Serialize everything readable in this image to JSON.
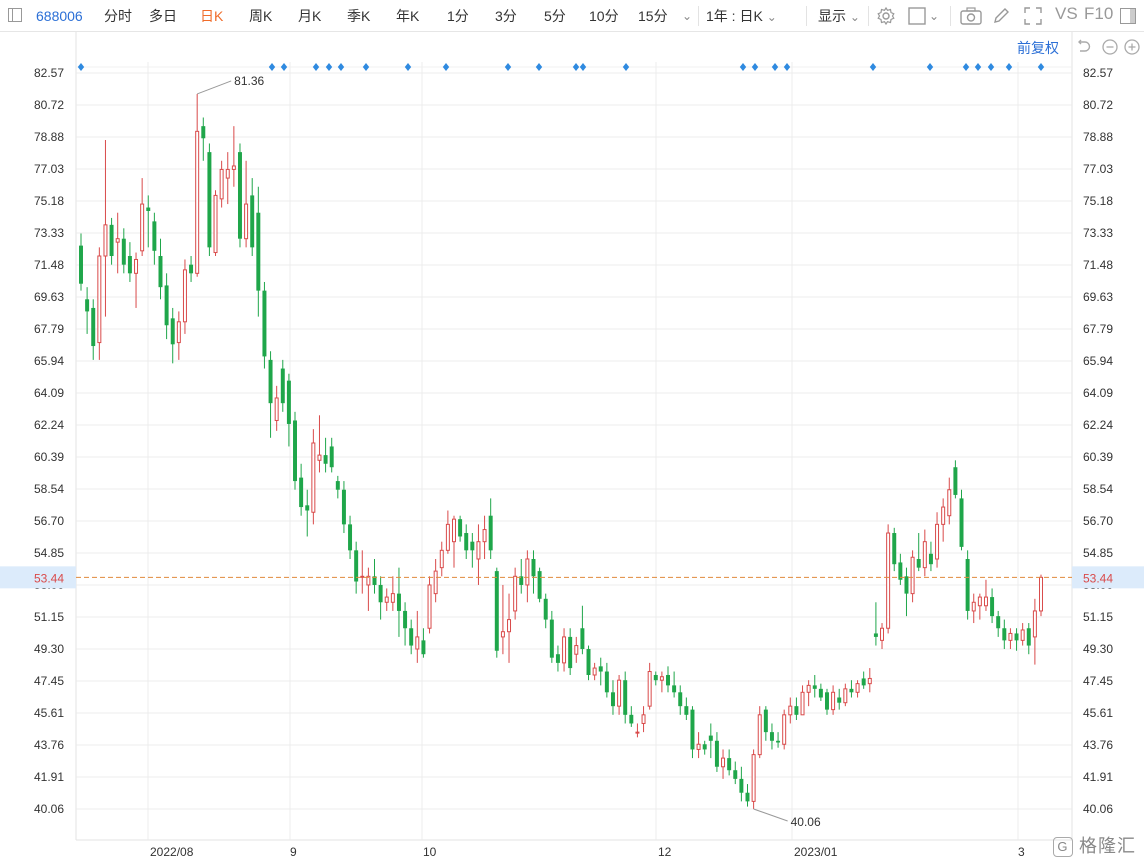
{
  "toolbar": {
    "stock_code": "688006",
    "periods": [
      "分时",
      "多日",
      "日K",
      "周K",
      "月K",
      "季K",
      "年K",
      "1分",
      "3分",
      "5分",
      "10分",
      "15分"
    ],
    "active_period": "日K",
    "range_select": "1年 : 日K",
    "display_label": "显示",
    "vs_label": "VS",
    "f10_label": "F10"
  },
  "chart_header": {
    "adjust_label": "前复权"
  },
  "chart_data": {
    "type": "candlestick",
    "y_ticks": [
      "82.57",
      "80.72",
      "78.88",
      "77.03",
      "75.18",
      "73.33",
      "71.48",
      "69.63",
      "67.79",
      "65.94",
      "64.09",
      "62.24",
      "60.39",
      "58.54",
      "56.70",
      "54.85",
      "53.00",
      "51.15",
      "49.30",
      "47.45",
      "45.61",
      "43.76",
      "41.91",
      "40.06"
    ],
    "ylim": [
      40.06,
      82.57
    ],
    "x_labels": [
      "2022/08",
      "9",
      "10",
      "12",
      "2023/01",
      "3"
    ],
    "current_price": "53.44",
    "current_price_value": 53.44,
    "annotations": [
      {
        "text": "81.36",
        "value": 81.36,
        "kind": "high"
      },
      {
        "text": "40.06",
        "value": 40.06,
        "kind": "low"
      }
    ],
    "colors": {
      "up": "#d94a4a",
      "down": "#1fa64a",
      "grid": "#ececec",
      "price_line": "#e08a3c",
      "price_tag_bg": "#dcebfb",
      "event_marker": "#2f8ae0"
    },
    "candles": [
      {
        "o": 72.6,
        "h": 73.3,
        "l": 70.0,
        "c": 70.4
      },
      {
        "o": 69.5,
        "h": 70.2,
        "l": 67.5,
        "c": 68.8
      },
      {
        "o": 69.0,
        "h": 69.5,
        "l": 66.0,
        "c": 66.8
      },
      {
        "o": 67.0,
        "h": 72.5,
        "l": 66.0,
        "c": 72.0
      },
      {
        "o": 72.0,
        "h": 78.7,
        "l": 68.5,
        "c": 73.8
      },
      {
        "o": 73.8,
        "h": 74.2,
        "l": 71.5,
        "c": 72.0
      },
      {
        "o": 72.8,
        "h": 74.5,
        "l": 71.0,
        "c": 73.0
      },
      {
        "o": 73.0,
        "h": 73.6,
        "l": 71.0,
        "c": 71.5
      },
      {
        "o": 72.0,
        "h": 72.8,
        "l": 70.5,
        "c": 71.0
      },
      {
        "o": 71.0,
        "h": 72.2,
        "l": 69.0,
        "c": 71.8
      },
      {
        "o": 72.3,
        "h": 76.5,
        "l": 72.0,
        "c": 75.0
      },
      {
        "o": 74.8,
        "h": 75.5,
        "l": 72.5,
        "c": 74.6
      },
      {
        "o": 74.0,
        "h": 74.5,
        "l": 71.5,
        "c": 72.3
      },
      {
        "o": 72.0,
        "h": 73.0,
        "l": 69.5,
        "c": 70.2
      },
      {
        "o": 70.3,
        "h": 71.0,
        "l": 67.2,
        "c": 68.0
      },
      {
        "o": 68.4,
        "h": 69.0,
        "l": 65.8,
        "c": 66.9
      },
      {
        "o": 67.0,
        "h": 68.8,
        "l": 66.0,
        "c": 68.2
      },
      {
        "o": 68.2,
        "h": 71.8,
        "l": 67.5,
        "c": 71.2
      },
      {
        "o": 71.5,
        "h": 72.0,
        "l": 70.5,
        "c": 71.0
      },
      {
        "o": 71.0,
        "h": 81.36,
        "l": 70.8,
        "c": 79.2
      },
      {
        "o": 79.5,
        "h": 80.0,
        "l": 77.5,
        "c": 78.8
      },
      {
        "o": 78.0,
        "h": 78.5,
        "l": 72.0,
        "c": 72.5
      },
      {
        "o": 72.2,
        "h": 75.8,
        "l": 72.0,
        "c": 75.5
      },
      {
        "o": 75.3,
        "h": 77.5,
        "l": 74.8,
        "c": 77.0
      },
      {
        "o": 76.5,
        "h": 78.0,
        "l": 75.0,
        "c": 77.0
      },
      {
        "o": 77.0,
        "h": 79.5,
        "l": 76.0,
        "c": 77.2
      },
      {
        "o": 78.0,
        "h": 78.5,
        "l": 72.5,
        "c": 73.0
      },
      {
        "o": 73.0,
        "h": 77.5,
        "l": 72.5,
        "c": 75.0
      },
      {
        "o": 75.5,
        "h": 76.5,
        "l": 72.0,
        "c": 72.5
      },
      {
        "o": 74.5,
        "h": 76.0,
        "l": 68.5,
        "c": 70.0
      },
      {
        "o": 70.0,
        "h": 70.5,
        "l": 65.5,
        "c": 66.2
      },
      {
        "o": 66.0,
        "h": 66.5,
        "l": 61.5,
        "c": 63.5
      },
      {
        "o": 62.5,
        "h": 64.5,
        "l": 61.9,
        "c": 63.8
      },
      {
        "o": 65.5,
        "h": 66.0,
        "l": 63.0,
        "c": 63.5
      },
      {
        "o": 64.8,
        "h": 65.2,
        "l": 61.0,
        "c": 62.3
      },
      {
        "o": 62.5,
        "h": 63.0,
        "l": 58.5,
        "c": 59.0
      },
      {
        "o": 59.2,
        "h": 60.0,
        "l": 57.0,
        "c": 57.5
      },
      {
        "o": 57.6,
        "h": 58.5,
        "l": 55.8,
        "c": 57.3
      },
      {
        "o": 57.2,
        "h": 62.0,
        "l": 56.5,
        "c": 61.2
      },
      {
        "o": 60.2,
        "h": 62.8,
        "l": 59.5,
        "c": 60.5
      },
      {
        "o": 60.5,
        "h": 61.5,
        "l": 59.5,
        "c": 60.0
      },
      {
        "o": 61.0,
        "h": 61.5,
        "l": 59.5,
        "c": 59.8
      },
      {
        "o": 59.0,
        "h": 59.3,
        "l": 58.0,
        "c": 58.5
      },
      {
        "o": 58.5,
        "h": 59.0,
        "l": 56.0,
        "c": 56.5
      },
      {
        "o": 56.5,
        "h": 57.0,
        "l": 54.5,
        "c": 55.0
      },
      {
        "o": 55.0,
        "h": 55.5,
        "l": 52.5,
        "c": 53.2
      },
      {
        "o": 53.5,
        "h": 55.0,
        "l": 52.5,
        "c": 53.5
      },
      {
        "o": 53.0,
        "h": 54.0,
        "l": 51.5,
        "c": 53.5
      },
      {
        "o": 53.5,
        "h": 54.5,
        "l": 52.5,
        "c": 53.0
      },
      {
        "o": 53.0,
        "h": 53.5,
        "l": 51.0,
        "c": 52.0
      },
      {
        "o": 52.0,
        "h": 52.8,
        "l": 51.5,
        "c": 52.3
      },
      {
        "o": 52.0,
        "h": 53.5,
        "l": 51.5,
        "c": 52.5
      },
      {
        "o": 52.5,
        "h": 54.0,
        "l": 50.0,
        "c": 51.5
      },
      {
        "o": 51.5,
        "h": 52.0,
        "l": 49.5,
        "c": 50.5
      },
      {
        "o": 50.5,
        "h": 51.0,
        "l": 49.0,
        "c": 49.5
      },
      {
        "o": 49.3,
        "h": 51.5,
        "l": 48.5,
        "c": 50.0
      },
      {
        "o": 49.8,
        "h": 50.5,
        "l": 48.8,
        "c": 49.0
      },
      {
        "o": 50.5,
        "h": 53.5,
        "l": 50.2,
        "c": 53.0
      },
      {
        "o": 52.5,
        "h": 54.5,
        "l": 52.0,
        "c": 53.8
      },
      {
        "o": 54.0,
        "h": 55.5,
        "l": 53.5,
        "c": 55.0
      },
      {
        "o": 55.0,
        "h": 57.3,
        "l": 54.8,
        "c": 56.5
      },
      {
        "o": 55.5,
        "h": 57.0,
        "l": 54.0,
        "c": 56.8
      },
      {
        "o": 56.8,
        "h": 57.0,
        "l": 55.5,
        "c": 55.8
      },
      {
        "o": 56.0,
        "h": 56.5,
        "l": 54.5,
        "c": 55.0
      },
      {
        "o": 55.5,
        "h": 56.0,
        "l": 54.0,
        "c": 55.0
      },
      {
        "o": 54.5,
        "h": 56.5,
        "l": 53.0,
        "c": 55.5
      },
      {
        "o": 55.5,
        "h": 57.0,
        "l": 54.5,
        "c": 56.2
      },
      {
        "o": 57.0,
        "h": 58.0,
        "l": 54.5,
        "c": 55.0
      },
      {
        "o": 53.8,
        "h": 54.0,
        "l": 48.8,
        "c": 49.2
      },
      {
        "o": 50.0,
        "h": 53.0,
        "l": 49.0,
        "c": 50.3
      },
      {
        "o": 50.3,
        "h": 52.5,
        "l": 48.5,
        "c": 51.0
      },
      {
        "o": 51.5,
        "h": 54.0,
        "l": 51.0,
        "c": 53.5
      },
      {
        "o": 53.5,
        "h": 54.5,
        "l": 52.5,
        "c": 53.0
      },
      {
        "o": 53.0,
        "h": 55.0,
        "l": 52.0,
        "c": 54.5
      },
      {
        "o": 54.5,
        "h": 55.0,
        "l": 52.5,
        "c": 53.5
      },
      {
        "o": 53.8,
        "h": 54.0,
        "l": 52.0,
        "c": 52.2
      },
      {
        "o": 52.2,
        "h": 52.5,
        "l": 50.5,
        "c": 51.0
      },
      {
        "o": 51.0,
        "h": 51.5,
        "l": 48.5,
        "c": 48.8
      },
      {
        "o": 49.0,
        "h": 49.5,
        "l": 48.0,
        "c": 48.5
      },
      {
        "o": 48.5,
        "h": 50.5,
        "l": 48.0,
        "c": 50.0
      },
      {
        "o": 50.0,
        "h": 50.5,
        "l": 47.8,
        "c": 48.2
      },
      {
        "o": 49.0,
        "h": 50.0,
        "l": 48.5,
        "c": 49.5
      },
      {
        "o": 50.5,
        "h": 51.8,
        "l": 49.0,
        "c": 49.3
      },
      {
        "o": 49.3,
        "h": 49.5,
        "l": 47.5,
        "c": 47.8
      },
      {
        "o": 47.8,
        "h": 48.5,
        "l": 47.5,
        "c": 48.2
      },
      {
        "o": 48.3,
        "h": 48.8,
        "l": 47.2,
        "c": 48.0
      },
      {
        "o": 48.0,
        "h": 48.5,
        "l": 46.5,
        "c": 46.8
      },
      {
        "o": 46.8,
        "h": 47.5,
        "l": 45.5,
        "c": 46.0
      },
      {
        "o": 46.0,
        "h": 47.8,
        "l": 45.5,
        "c": 47.5
      },
      {
        "o": 47.5,
        "h": 48.0,
        "l": 45.0,
        "c": 45.5
      },
      {
        "o": 45.5,
        "h": 46.0,
        "l": 44.8,
        "c": 45.0
      },
      {
        "o": 44.5,
        "h": 45.0,
        "l": 44.2,
        "c": 44.5
      },
      {
        "o": 45.0,
        "h": 46.0,
        "l": 44.5,
        "c": 45.5
      },
      {
        "o": 46.0,
        "h": 48.5,
        "l": 45.8,
        "c": 48.0
      },
      {
        "o": 47.8,
        "h": 48.0,
        "l": 47.2,
        "c": 47.5
      },
      {
        "o": 47.5,
        "h": 48.0,
        "l": 46.8,
        "c": 47.7
      },
      {
        "o": 47.8,
        "h": 48.3,
        "l": 46.8,
        "c": 47.2
      },
      {
        "o": 47.2,
        "h": 48.0,
        "l": 46.5,
        "c": 46.8
      },
      {
        "o": 46.8,
        "h": 47.2,
        "l": 45.5,
        "c": 46.0
      },
      {
        "o": 46.0,
        "h": 46.5,
        "l": 45.2,
        "c": 45.5
      },
      {
        "o": 45.8,
        "h": 46.0,
        "l": 43.0,
        "c": 43.5
      },
      {
        "o": 43.5,
        "h": 44.5,
        "l": 43.0,
        "c": 43.8
      },
      {
        "o": 43.8,
        "h": 44.0,
        "l": 43.2,
        "c": 43.5
      },
      {
        "o": 44.3,
        "h": 45.0,
        "l": 43.0,
        "c": 44.0
      },
      {
        "o": 44.0,
        "h": 44.5,
        "l": 42.2,
        "c": 42.5
      },
      {
        "o": 42.5,
        "h": 43.5,
        "l": 41.8,
        "c": 43.0
      },
      {
        "o": 43.0,
        "h": 43.5,
        "l": 42.0,
        "c": 42.3
      },
      {
        "o": 42.3,
        "h": 42.8,
        "l": 41.5,
        "c": 41.8
      },
      {
        "o": 41.8,
        "h": 42.5,
        "l": 40.5,
        "c": 41.0
      },
      {
        "o": 41.0,
        "h": 41.5,
        "l": 40.2,
        "c": 40.5
      },
      {
        "o": 40.5,
        "h": 43.5,
        "l": 40.06,
        "c": 43.2
      },
      {
        "o": 43.2,
        "h": 46.0,
        "l": 43.0,
        "c": 45.5
      },
      {
        "o": 45.8,
        "h": 46.0,
        "l": 44.0,
        "c": 44.5
      },
      {
        "o": 44.5,
        "h": 45.0,
        "l": 43.5,
        "c": 44.0
      },
      {
        "o": 44.0,
        "h": 44.5,
        "l": 43.6,
        "c": 43.9
      },
      {
        "o": 43.8,
        "h": 45.8,
        "l": 43.5,
        "c": 45.5
      },
      {
        "o": 45.5,
        "h": 46.5,
        "l": 45.0,
        "c": 46.0
      },
      {
        "o": 46.0,
        "h": 46.5,
        "l": 45.2,
        "c": 45.5
      },
      {
        "o": 45.5,
        "h": 47.2,
        "l": 45.5,
        "c": 46.8
      },
      {
        "o": 46.8,
        "h": 47.5,
        "l": 46.0,
        "c": 47.2
      },
      {
        "o": 47.2,
        "h": 47.8,
        "l": 46.5,
        "c": 47.0
      },
      {
        "o": 47.0,
        "h": 47.3,
        "l": 46.3,
        "c": 46.5
      },
      {
        "o": 46.8,
        "h": 47.0,
        "l": 45.5,
        "c": 45.8
      },
      {
        "o": 45.8,
        "h": 47.2,
        "l": 45.5,
        "c": 46.8
      },
      {
        "o": 46.5,
        "h": 47.0,
        "l": 45.8,
        "c": 46.2
      },
      {
        "o": 46.2,
        "h": 47.3,
        "l": 46.0,
        "c": 47.0
      },
      {
        "o": 47.0,
        "h": 47.5,
        "l": 46.5,
        "c": 46.8
      },
      {
        "o": 46.8,
        "h": 47.5,
        "l": 46.5,
        "c": 47.3
      },
      {
        "o": 47.6,
        "h": 48.0,
        "l": 47.0,
        "c": 47.2
      },
      {
        "o": 47.3,
        "h": 48.2,
        "l": 46.8,
        "c": 47.6
      },
      {
        "o": 50.2,
        "h": 52.0,
        "l": 49.5,
        "c": 50.0
      },
      {
        "o": 49.8,
        "h": 50.8,
        "l": 49.3,
        "c": 50.5
      },
      {
        "o": 50.5,
        "h": 56.5,
        "l": 50.2,
        "c": 56.0
      },
      {
        "o": 56.0,
        "h": 56.3,
        "l": 53.8,
        "c": 54.2
      },
      {
        "o": 54.3,
        "h": 54.8,
        "l": 53.0,
        "c": 53.3
      },
      {
        "o": 53.5,
        "h": 54.0,
        "l": 51.2,
        "c": 52.5
      },
      {
        "o": 52.5,
        "h": 55.0,
        "l": 52.0,
        "c": 54.6
      },
      {
        "o": 54.5,
        "h": 56.0,
        "l": 53.8,
        "c": 54.0
      },
      {
        "o": 54.0,
        "h": 56.2,
        "l": 53.5,
        "c": 55.5
      },
      {
        "o": 54.8,
        "h": 55.5,
        "l": 53.8,
        "c": 54.2
      },
      {
        "o": 54.5,
        "h": 57.2,
        "l": 54.0,
        "c": 56.5
      },
      {
        "o": 56.5,
        "h": 58.0,
        "l": 55.5,
        "c": 57.5
      },
      {
        "o": 57.0,
        "h": 59.2,
        "l": 56.5,
        "c": 58.5
      },
      {
        "o": 59.8,
        "h": 60.2,
        "l": 58.0,
        "c": 58.2
      },
      {
        "o": 58.0,
        "h": 58.5,
        "l": 55.0,
        "c": 55.2
      },
      {
        "o": 54.5,
        "h": 55.0,
        "l": 51.0,
        "c": 51.5
      },
      {
        "o": 51.5,
        "h": 52.5,
        "l": 50.8,
        "c": 52.0
      },
      {
        "o": 51.8,
        "h": 52.5,
        "l": 51.0,
        "c": 52.3
      },
      {
        "o": 51.8,
        "h": 53.3,
        "l": 51.5,
        "c": 52.3
      },
      {
        "o": 52.3,
        "h": 52.8,
        "l": 50.8,
        "c": 51.2
      },
      {
        "o": 51.2,
        "h": 51.5,
        "l": 50.0,
        "c": 50.5
      },
      {
        "o": 50.5,
        "h": 51.0,
        "l": 49.3,
        "c": 49.8
      },
      {
        "o": 49.8,
        "h": 50.5,
        "l": 49.3,
        "c": 50.2
      },
      {
        "o": 50.2,
        "h": 50.5,
        "l": 49.2,
        "c": 49.8
      },
      {
        "o": 49.8,
        "h": 50.8,
        "l": 49.5,
        "c": 50.4
      },
      {
        "o": 50.5,
        "h": 50.8,
        "l": 49.0,
        "c": 49.5
      },
      {
        "o": 50.0,
        "h": 52.2,
        "l": 48.4,
        "c": 51.5
      },
      {
        "o": 51.5,
        "h": 53.6,
        "l": 51.2,
        "c": 53.44
      }
    ],
    "events": [
      {
        "date": "2022/08/30"
      },
      {
        "date": "2022/08/31"
      },
      {
        "date": "2022/09/05"
      },
      {
        "date": "2022/09/07"
      },
      {
        "date": "2022/09/08"
      },
      {
        "date": "2022/09/13"
      },
      {
        "date": "2022/09/20"
      },
      {
        "date": "2022/09/27"
      },
      {
        "date": "2022/10/12"
      },
      {
        "date": "2022/10/17"
      },
      {
        "date": "2022/10/24"
      },
      {
        "date": "2022/10/25"
      },
      {
        "date": "2022/10/31"
      },
      {
        "date": "2022/12/22"
      },
      {
        "date": "2022/12/26"
      },
      {
        "date": "2023/01/03"
      },
      {
        "date": "2023/01/05"
      },
      {
        "date": "2023/01/19"
      },
      {
        "date": "2023/02/08"
      },
      {
        "date": "2023/02/15"
      },
      {
        "date": "2023/02/17"
      },
      {
        "date": "2023/02/20"
      },
      {
        "date": "2023/02/23"
      },
      {
        "date": "2023/03/02"
      }
    ]
  },
  "watermark": "格隆汇"
}
